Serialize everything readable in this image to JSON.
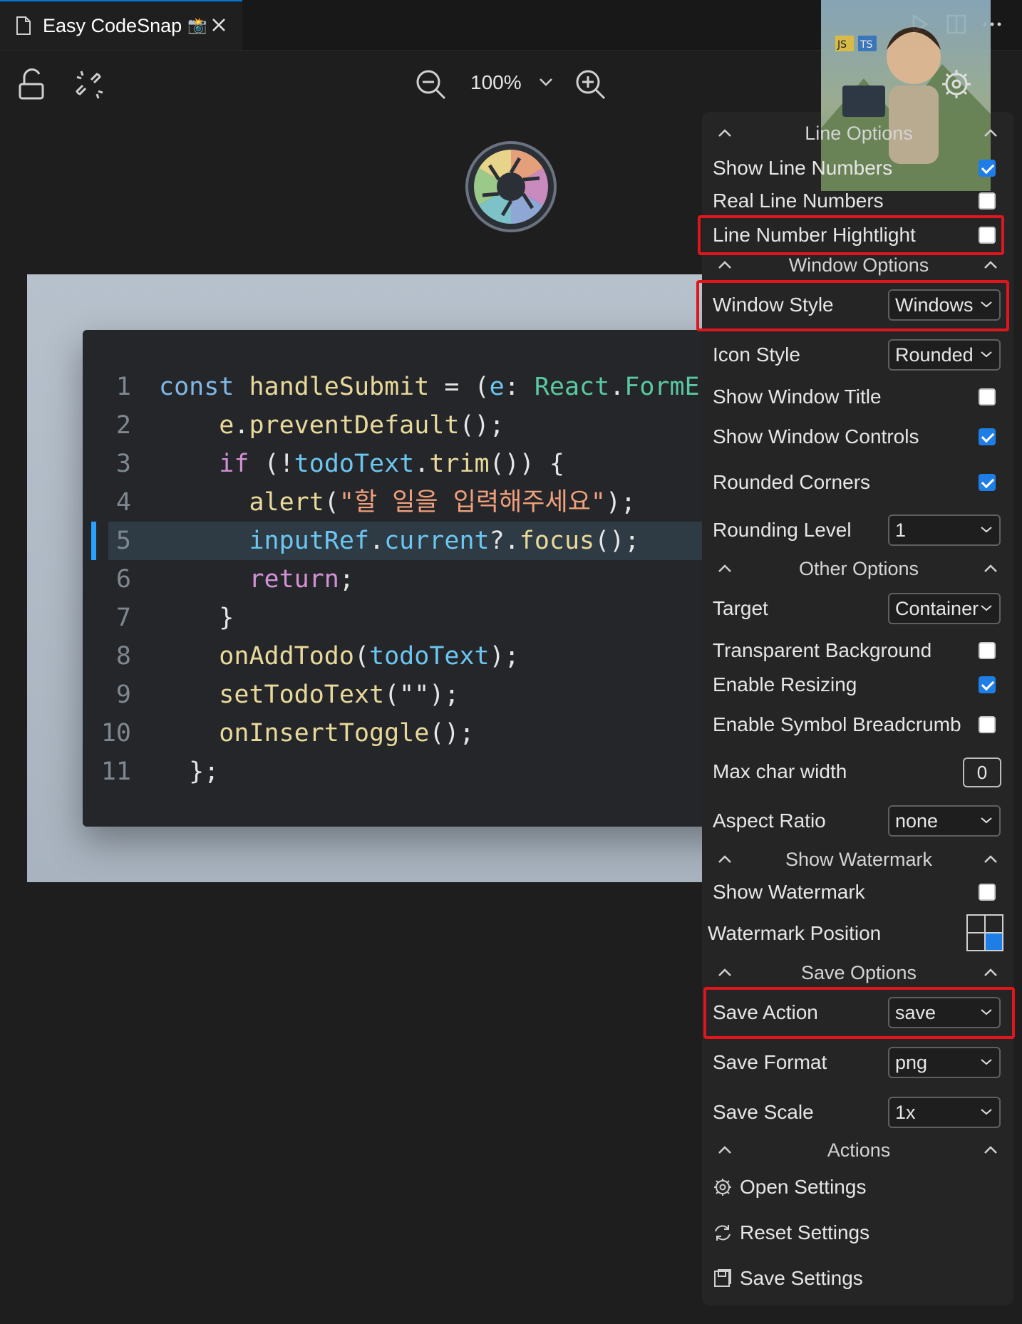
{
  "tab": {
    "title": "Easy CodeSnap",
    "emoji": "📸"
  },
  "toolbar": {
    "zoom": "100%"
  },
  "colors": {
    "accent": "#1f7ee6",
    "highlight_box": "#e0161f",
    "panel_bg": "#252526"
  },
  "code": {
    "lines": [
      {
        "n": "1",
        "parts": [
          [
            "k",
            "const "
          ],
          [
            "f",
            "handleSubmit "
          ],
          [
            "p",
            "= ("
          ],
          [
            "v",
            "e"
          ],
          [
            "p",
            ": "
          ],
          [
            "t",
            "React"
          ],
          [
            "p",
            "."
          ],
          [
            "t",
            "FormE"
          ]
        ]
      },
      {
        "n": "2",
        "parts": [
          [
            "p",
            "    "
          ],
          [
            "f",
            "e"
          ],
          [
            "p",
            "."
          ],
          [
            "f",
            "preventDefault"
          ],
          [
            "p",
            "();"
          ]
        ]
      },
      {
        "n": "3",
        "parts": [
          [
            "p",
            "    "
          ],
          [
            "r",
            "if"
          ],
          [
            "p",
            " (!"
          ],
          [
            "v",
            "todoText"
          ],
          [
            "p",
            "."
          ],
          [
            "f",
            "trim"
          ],
          [
            "p",
            "()) {"
          ]
        ]
      },
      {
        "n": "4",
        "parts": [
          [
            "p",
            "      "
          ],
          [
            "f",
            "alert"
          ],
          [
            "p",
            "("
          ],
          [
            "s",
            "\"할 일을 입력해주세요\""
          ],
          [
            "p",
            ");"
          ]
        ]
      },
      {
        "n": "5",
        "parts": [
          [
            "p",
            "      "
          ],
          [
            "v",
            "inputRef"
          ],
          [
            "p",
            "."
          ],
          [
            "v",
            "current"
          ],
          [
            "p",
            "?."
          ],
          [
            "f",
            "focus"
          ],
          [
            "p",
            "();"
          ]
        ],
        "highlight": true
      },
      {
        "n": "6",
        "parts": [
          [
            "p",
            "      "
          ],
          [
            "r",
            "return"
          ],
          [
            "p",
            ";"
          ]
        ]
      },
      {
        "n": "7",
        "parts": [
          [
            "p",
            "    }"
          ]
        ]
      },
      {
        "n": "8",
        "parts": [
          [
            "p",
            "    "
          ],
          [
            "f",
            "onAddTodo"
          ],
          [
            "p",
            "("
          ],
          [
            "v",
            "todoText"
          ],
          [
            "p",
            ");"
          ]
        ]
      },
      {
        "n": "9",
        "parts": [
          [
            "p",
            "    "
          ],
          [
            "f",
            "setTodoText"
          ],
          [
            "p",
            "(\"\");"
          ]
        ]
      },
      {
        "n": "10",
        "parts": [
          [
            "p",
            "    "
          ],
          [
            "f",
            "onInsertToggle"
          ],
          [
            "p",
            "();"
          ]
        ]
      },
      {
        "n": "11",
        "parts": [
          [
            "p",
            "  };"
          ]
        ]
      }
    ]
  },
  "panel": {
    "sections": {
      "line": "Line Options",
      "window": "Window Options",
      "other": "Other Options",
      "watermark": "Show Watermark",
      "save": "Save Options",
      "actions": "Actions"
    },
    "line_options": {
      "show_line_numbers": "Show Line Numbers",
      "real_line_numbers": "Real Line Numbers",
      "line_number_highlight": "Line Number Hightlight"
    },
    "window_options": {
      "window_style_label": "Window Style",
      "window_style_value": "Windows",
      "icon_style_label": "Icon Style",
      "icon_style_value": "Rounded",
      "show_window_title": "Show Window Title",
      "show_window_controls": "Show Window Controls",
      "rounded_corners": "Rounded Corners",
      "rounding_level_label": "Rounding Level",
      "rounding_level_value": "1"
    },
    "other_options": {
      "target_label": "Target",
      "target_value": "Container",
      "transparent_background": "Transparent Background",
      "enable_resizing": "Enable Resizing",
      "enable_symbol_breadcrumb": "Enable Symbol Breadcrumb",
      "max_char_width_label": "Max char width",
      "max_char_width_value": "0",
      "aspect_ratio_label": "Aspect Ratio",
      "aspect_ratio_value": "none"
    },
    "watermark_options": {
      "show_watermark": "Show Watermark",
      "watermark_position": "Watermark Position"
    },
    "save_options": {
      "save_action_label": "Save Action",
      "save_action_value": "save",
      "save_format_label": "Save Format",
      "save_format_value": "png",
      "save_scale_label": "Save Scale",
      "save_scale_value": "1x"
    },
    "actions": {
      "open_settings": "Open Settings",
      "reset_settings": "Reset Settings",
      "save_settings": "Save Settings"
    },
    "checkbox_states": {
      "show_line_numbers": true,
      "real_line_numbers": false,
      "line_number_highlight": false,
      "show_window_title": false,
      "show_window_controls": true,
      "rounded_corners": true,
      "transparent_background": false,
      "enable_resizing": true,
      "enable_symbol_breadcrumb": false,
      "show_watermark": false
    }
  },
  "avatar": {
    "badges": [
      "JS",
      "TS"
    ]
  }
}
